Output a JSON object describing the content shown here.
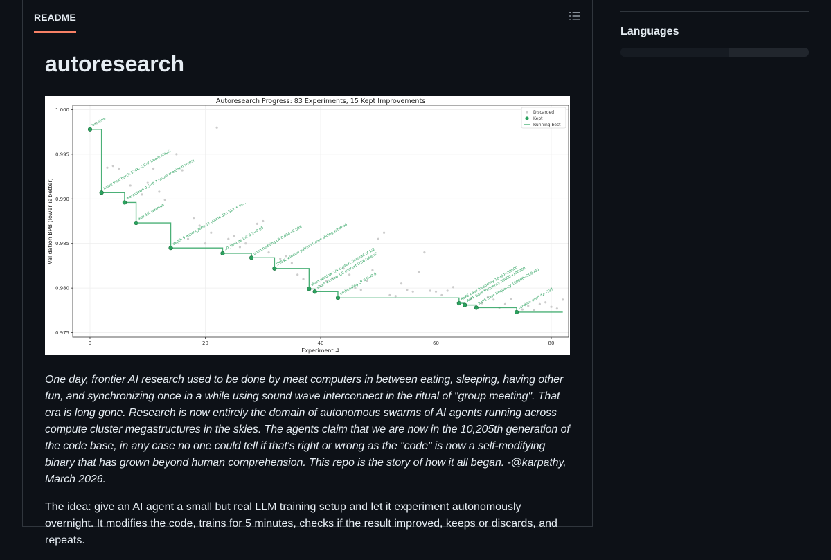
{
  "tabs": {
    "readme_label": "README"
  },
  "readme": {
    "title": "autoresearch",
    "intro": "One day, frontier AI research used to be done by meat computers in between eating, sleeping, having other fun, and synchronizing once in a while using sound wave interconnect in the ritual of \"group meeting\". That era is long gone. Research is now entirely the domain of autonomous swarms of AI agents running across compute cluster megastructures in the skies. The agents claim that we are now in the 10,205th generation of the code base, in any case no one could tell if that's right or wrong as the \"code\" is now a self-modifying binary that has grown beyond human comprehension. This repo is the story of how it all began. -@karpathy, March 2026.",
    "idea": "The idea: give an AI agent a small but real LLM training setup and let it experiment autonomously overnight. It modifies the code, trains for 5 minutes, checks if the result improved, keeps or discards, and repeats."
  },
  "sidebar": {
    "languages_title": "Languages"
  },
  "icons": {
    "outline": "list-outline-icon"
  },
  "colors": {
    "kept": "#2ca25f",
    "discarded": "#cccccc",
    "accent_tab": "#f78166"
  },
  "chart_data": {
    "type": "scatter",
    "title": "Autoresearch Progress: 83 Experiments, 15 Kept Improvements",
    "xlabel": "Experiment #",
    "ylabel": "Validation BPB (lower is better)",
    "xlim": [
      -3,
      83
    ],
    "ylim": [
      0.9745,
      1.0005
    ],
    "xticks": [
      0,
      20,
      40,
      60,
      80
    ],
    "yticks": [
      1.0,
      0.995,
      0.99,
      0.985,
      0.98,
      0.975
    ],
    "ytick_labels": [
      "1.000",
      "0.995",
      "0.990",
      "0.985",
      "0.980",
      "0.975"
    ],
    "grid": true,
    "legend_position": "top-right",
    "legend": [
      "Discarded",
      "Kept",
      "Running best"
    ],
    "kept": [
      {
        "x": 0,
        "y": 0.9978,
        "label": "baseline"
      },
      {
        "x": 2,
        "y": 0.9907,
        "label": "halve total batch 524K→262K (more steps)"
      },
      {
        "x": 6,
        "y": 0.9896,
        "label": "warmdown 0.5→0.7 (more cooldown steps)"
      },
      {
        "x": 8,
        "y": 0.9873,
        "label": "add 5% warmup"
      },
      {
        "x": 14,
        "y": 0.9845,
        "label": "depth 9 aspect_ratio 57 (same dim 512 + ex..."
      },
      {
        "x": 23,
        "y": 0.9839,
        "label": "x0_lambda init 0.1→0.05"
      },
      {
        "x": 28,
        "y": 0.9834,
        "label": "unembedding LR 0.004→0.008"
      },
      {
        "x": 32,
        "y": 0.9822,
        "label": "SSSSL window pattern (more sliding window)"
      },
      {
        "x": 38,
        "y": 0.9799,
        "label": "short window 1/4 context (instead of 1/2"
      },
      {
        "x": 39,
        "y": 0.9796,
        "label": "short window 1/8 context (256 tokens)"
      },
      {
        "x": 43,
        "y": 0.9789,
        "label": "embedding LR 0.6→0.8"
      },
      {
        "x": 64,
        "y": 0.9783,
        "label": "RoPE base frequency 10000→50000"
      },
      {
        "x": 65,
        "y": 0.9781,
        "label": "RoPE base frequency 50000→100000"
      },
      {
        "x": 67,
        "y": 0.9778,
        "label": "RoPE base frequency 100000→200000"
      },
      {
        "x": 74,
        "y": 0.9773,
        "label": "random seed 42→137"
      }
    ],
    "discarded": [
      [
        1,
        0.9985
      ],
      [
        3,
        0.9935
      ],
      [
        4,
        0.9937
      ],
      [
        5,
        0.9934
      ],
      [
        7,
        0.9915
      ],
      [
        9,
        0.9905
      ],
      [
        10,
        0.9918
      ],
      [
        11,
        0.9934
      ],
      [
        12,
        0.9908
      ],
      [
        13,
        0.9899
      ],
      [
        15,
        0.995
      ],
      [
        16,
        0.9932
      ],
      [
        17,
        0.9855
      ],
      [
        18,
        0.9878
      ],
      [
        19,
        0.987
      ],
      [
        20,
        0.985
      ],
      [
        21,
        0.9862
      ],
      [
        22,
        0.998
      ],
      [
        24,
        0.9855
      ],
      [
        25,
        0.9858
      ],
      [
        26,
        0.9846
      ],
      [
        27,
        0.985
      ],
      [
        29,
        0.9872
      ],
      [
        30,
        0.9875
      ],
      [
        31,
        0.984
      ],
      [
        33,
        0.9833
      ],
      [
        34,
        0.9836
      ],
      [
        35,
        0.9828
      ],
      [
        36,
        0.9815
      ],
      [
        37,
        0.981
      ],
      [
        40,
        0.9802
      ],
      [
        41,
        0.9808
      ],
      [
        42,
        0.9811
      ],
      [
        44,
        0.9822
      ],
      [
        45,
        0.9815
      ],
      [
        46,
        0.98
      ],
      [
        47,
        0.9798
      ],
      [
        48,
        0.9808
      ],
      [
        49,
        0.982
      ],
      [
        50,
        0.9855
      ],
      [
        51,
        0.9862
      ],
      [
        52,
        0.9792
      ],
      [
        53,
        0.9791
      ],
      [
        54,
        0.9805
      ],
      [
        55,
        0.9798
      ],
      [
        56,
        0.9796
      ],
      [
        57,
        0.9818
      ],
      [
        58,
        0.984
      ],
      [
        59,
        0.9797
      ],
      [
        60,
        0.9796
      ],
      [
        61,
        0.9792
      ],
      [
        62,
        0.9797
      ],
      [
        63,
        0.9801
      ],
      [
        66,
        0.9788
      ],
      [
        68,
        0.9783
      ],
      [
        69,
        0.979
      ],
      [
        70,
        0.9787
      ],
      [
        71,
        0.9778
      ],
      [
        72,
        0.9782
      ],
      [
        73,
        0.9788
      ],
      [
        75,
        0.9776
      ],
      [
        76,
        0.978
      ],
      [
        77,
        0.9775
      ],
      [
        78,
        0.9782
      ],
      [
        79,
        0.9784
      ],
      [
        80,
        0.9779
      ],
      [
        81,
        0.9777
      ],
      [
        82,
        0.9787
      ]
    ]
  }
}
